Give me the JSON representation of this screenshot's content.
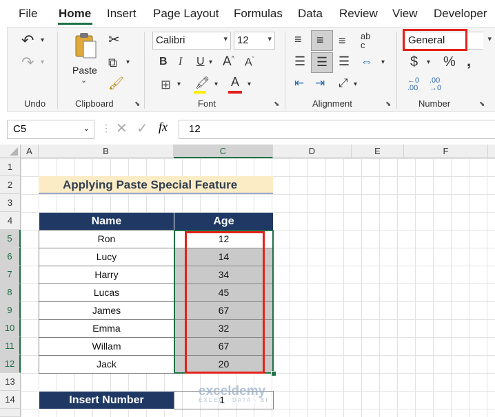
{
  "ribbon_tabs": [
    "File",
    "Home",
    "Insert",
    "Page Layout",
    "Formulas",
    "Data",
    "Review",
    "View",
    "Developer"
  ],
  "active_tab": "Home",
  "groups": {
    "undo": "Undo",
    "clipboard": "Clipboard",
    "paste": "Paste",
    "font": "Font",
    "alignment": "Alignment",
    "number": "Number"
  },
  "font_name": "Calibri",
  "font_size": "12",
  "number_format": "General",
  "name_box": "C5",
  "formula_value": "12",
  "columns": [
    "A",
    "B",
    "C",
    "D",
    "E",
    "F"
  ],
  "rows": [
    "1",
    "2",
    "3",
    "4",
    "5",
    "6",
    "7",
    "8",
    "9",
    "10",
    "11",
    "12",
    "13",
    "14"
  ],
  "sheet": {
    "title": "Applying Paste Special Feature",
    "header_name": "Name",
    "header_age": "Age",
    "records": [
      {
        "name": "Ron",
        "age": "12"
      },
      {
        "name": "Lucy",
        "age": "14"
      },
      {
        "name": "Harry",
        "age": "34"
      },
      {
        "name": "Lucas",
        "age": "45"
      },
      {
        "name": "James",
        "age": "67"
      },
      {
        "name": "Emma",
        "age": "32"
      },
      {
        "name": "Willam",
        "age": "67"
      },
      {
        "name": "Jack",
        "age": "20"
      }
    ],
    "insert_label": "Insert Number",
    "insert_value": "1"
  },
  "watermark": {
    "brand": "exceldemy",
    "tagline": "EXCEL · DATA · BI"
  },
  "colors": {
    "accent": "#1e7145",
    "header_fill": "#1f3864",
    "title_fill": "#fcecc6",
    "highlight": "#e32119"
  }
}
